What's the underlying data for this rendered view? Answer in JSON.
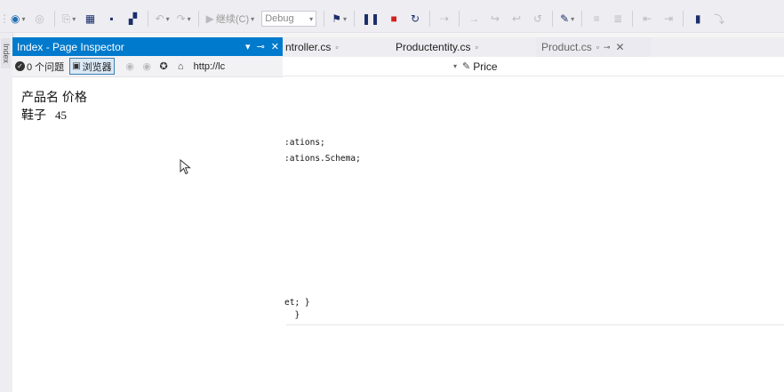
{
  "toolbar": {
    "continue_label": "继续(C)",
    "config_value": "Debug"
  },
  "side_strip": {
    "tab_label": "Index"
  },
  "inspector": {
    "title": "Index - Page Inspector",
    "issues_label": "0 个问题",
    "browser_label": "浏览器",
    "url_text": "http://lc",
    "content": {
      "header_row": "产品名 价格",
      "item_name": "鞋子",
      "item_price": "45"
    }
  },
  "tabs": [
    {
      "label": "ntroller.cs"
    },
    {
      "label": "Productentity.cs"
    },
    {
      "label": "Product.cs"
    }
  ],
  "navbar": {
    "member": "Price"
  },
  "code_lines": [
    ":ations;",
    ":ations.Schema;",
    "et; }",
    "  }"
  ],
  "colors": {
    "accent": "#007acc",
    "stop": "#d42020"
  }
}
